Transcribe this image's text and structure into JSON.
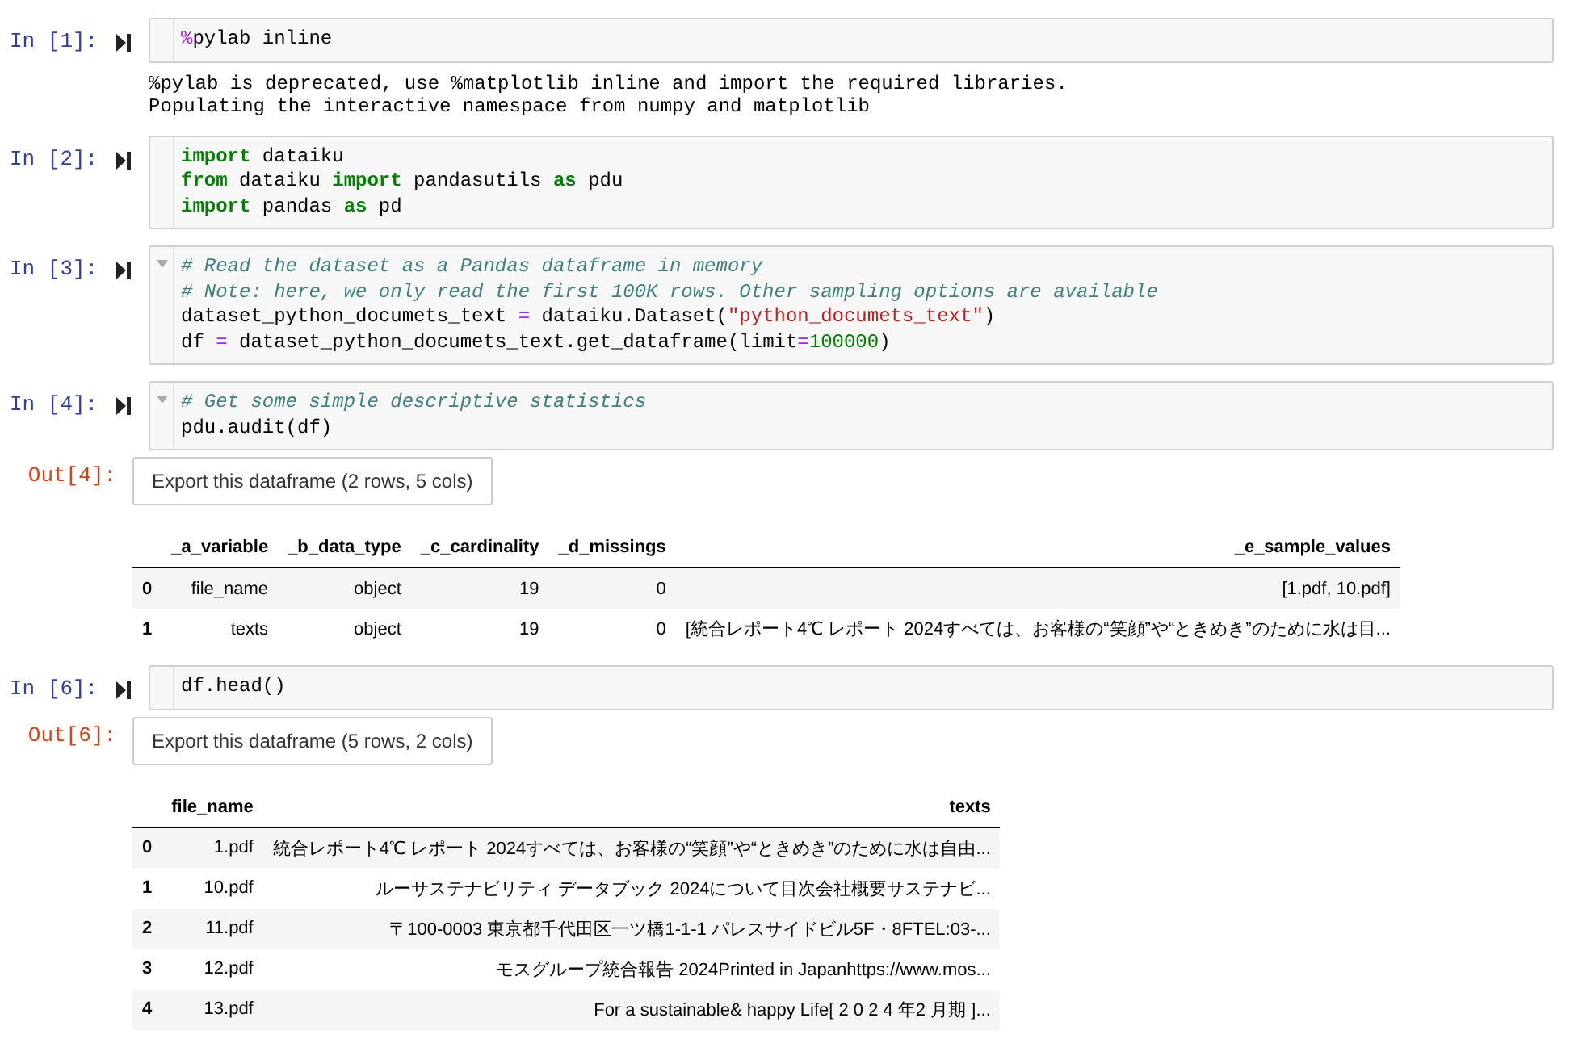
{
  "cells": [
    {
      "prompt": "In [1]:",
      "collapsible": false,
      "lines": [
        [
          {
            "kind": "magic",
            "text": "%"
          },
          {
            "kind": "plain",
            "text": "pylab inline"
          }
        ]
      ],
      "output": {
        "kind": "stream",
        "lines": [
          "%pylab is deprecated, use %matplotlib inline and import the required libraries.",
          "Populating the interactive namespace from numpy and matplotlib"
        ]
      }
    },
    {
      "prompt": "In [2]:",
      "collapsible": false,
      "lines": [
        [
          {
            "kind": "keyword",
            "text": "import"
          },
          {
            "kind": "plain",
            "text": " dataiku"
          }
        ],
        [
          {
            "kind": "keyword",
            "text": "from"
          },
          {
            "kind": "plain",
            "text": " dataiku "
          },
          {
            "kind": "keyword",
            "text": "import"
          },
          {
            "kind": "plain",
            "text": " pandasutils "
          },
          {
            "kind": "keyword",
            "text": "as"
          },
          {
            "kind": "plain",
            "text": " pdu"
          }
        ],
        [
          {
            "kind": "keyword",
            "text": "import"
          },
          {
            "kind": "plain",
            "text": " pandas "
          },
          {
            "kind": "keyword",
            "text": "as"
          },
          {
            "kind": "plain",
            "text": " pd"
          }
        ]
      ]
    },
    {
      "prompt": "In [3]:",
      "collapsible": true,
      "lines": [
        [
          {
            "kind": "comment",
            "text": "# Read the dataset as a Pandas dataframe in memory"
          }
        ],
        [
          {
            "kind": "comment",
            "text": "# Note: here, we only read the first 100K rows. Other sampling options are available"
          }
        ],
        [
          {
            "kind": "plain",
            "text": "dataset_python_documets_text "
          },
          {
            "kind": "operator",
            "text": "="
          },
          {
            "kind": "plain",
            "text": " dataiku.Dataset("
          },
          {
            "kind": "string",
            "text": "\"python_documets_text\""
          },
          {
            "kind": "plain",
            "text": ")"
          }
        ],
        [
          {
            "kind": "plain",
            "text": "df "
          },
          {
            "kind": "operator",
            "text": "="
          },
          {
            "kind": "plain",
            "text": " dataset_python_documets_text.get_dataframe(limit"
          },
          {
            "kind": "operator",
            "text": "="
          },
          {
            "kind": "number",
            "text": "100000"
          },
          {
            "kind": "plain",
            "text": ")"
          }
        ]
      ]
    },
    {
      "prompt": "In [4]:",
      "collapsible": true,
      "lines": [
        [
          {
            "kind": "comment",
            "text": "# Get some simple descriptive statistics"
          }
        ],
        [
          {
            "kind": "plain",
            "text": "pdu.audit(df)"
          }
        ]
      ],
      "output": {
        "kind": "dataframe",
        "prompt": "Out[4]:",
        "button": "Export this dataframe (2 rows, 5 cols)",
        "columns": [
          "_a_variable",
          "_b_data_type",
          "_c_cardinality",
          "_d_missings",
          "_e_sample_values"
        ],
        "rows": [
          {
            "index": "0",
            "cells": [
              "file_name",
              "object",
              "19",
              "0",
              "[1.pdf, 10.pdf]"
            ]
          },
          {
            "index": "1",
            "cells": [
              "texts",
              "object",
              "19",
              "0",
              "[統合レポート4℃ レポート 2024すべては、お客様の“笑顔”や“ときめき”のために水は目..."
            ]
          }
        ]
      }
    },
    {
      "prompt": "In [6]:",
      "collapsible": false,
      "lines": [
        [
          {
            "kind": "plain",
            "text": "df.head()"
          }
        ]
      ],
      "output": {
        "kind": "dataframe",
        "prompt": "Out[6]:",
        "button": "Export this dataframe (5 rows, 2 cols)",
        "columns": [
          "file_name",
          "texts"
        ],
        "rows": [
          {
            "index": "0",
            "cells": [
              "1.pdf",
              "統合レポート4℃ レポート 2024すべては、お客様の“笑顔”や“ときめき”のために水は自由..."
            ]
          },
          {
            "index": "1",
            "cells": [
              "10.pdf",
              "ルーサステナビリティ データブック 2024について目次会社概要サステナビ..."
            ]
          },
          {
            "index": "2",
            "cells": [
              "11.pdf",
              "〒100-0003 東京都千代田区一ツ橋1-1-1 パレスサイドビル5F・8FTEL:03-..."
            ]
          },
          {
            "index": "3",
            "cells": [
              "12.pdf",
              "モスグループ統合報告 2024Printed in Japanhttps://www.mos..."
            ]
          },
          {
            "index": "4",
            "cells": [
              "13.pdf",
              "For a sustainable& happy Life[ 2 0 2 4 年2 月期 ]..."
            ]
          }
        ]
      }
    }
  ]
}
